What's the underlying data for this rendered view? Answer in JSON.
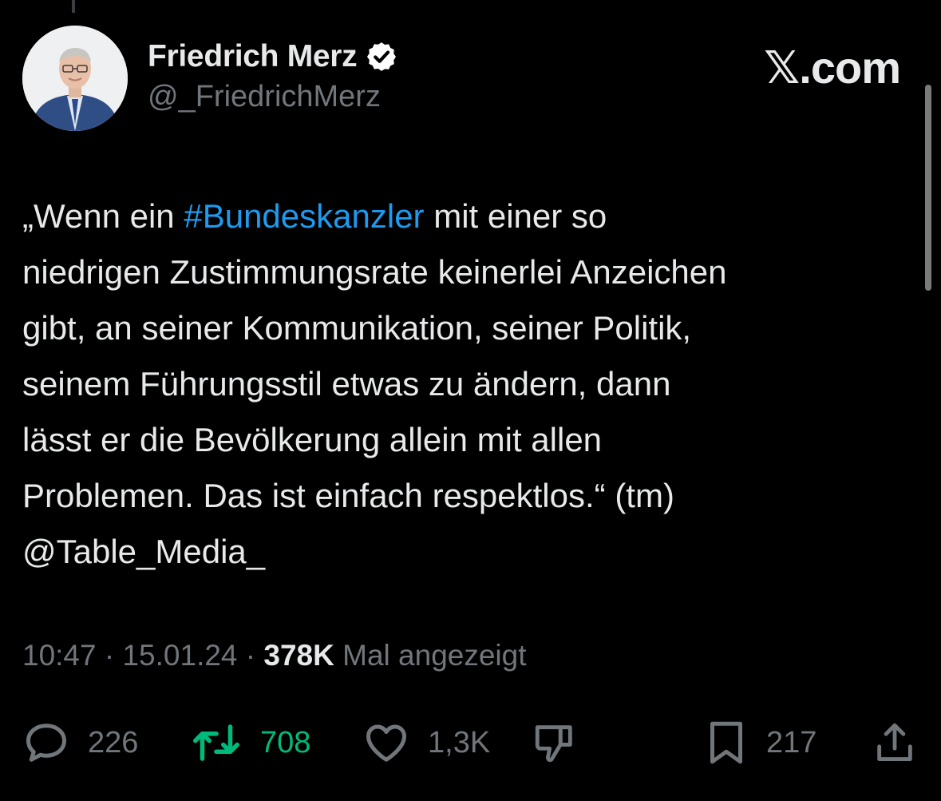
{
  "author": {
    "display_name": "Friedrich Merz",
    "handle": "@_FriedrichMerz"
  },
  "brand": "𝕏.com",
  "tweet": {
    "lines": [
      [
        "„Wenn ein ",
        "#Bundeskanzler",
        " mit einer so"
      ],
      "niedrigen Zustimmungsrate keinerlei Anzeichen",
      "gibt, an seiner Kommunikation, seiner Politik,",
      "seinem Führungsstil etwas zu ändern, dann",
      "lässt er die Bevölkerung allein mit allen",
      "Problemen. Das ist einfach respektlos.“ (tm)",
      "@Table_Media_"
    ]
  },
  "meta": {
    "time": "10:47",
    "separator": " · ",
    "date": "15.01.24",
    "views": "378K",
    "views_label": "Mal angezeigt"
  },
  "actions": {
    "replies": "226",
    "reposts": "708",
    "likes": "1,3K",
    "bookmarks": "217"
  },
  "colors": {
    "background": "#000000",
    "text": "#e7e9ea",
    "muted": "#71767b",
    "link": "#1d9bf0",
    "repost": "#00ba7c"
  },
  "icons": [
    "verified-badge-icon",
    "reply-icon",
    "repost-icon",
    "like-icon",
    "dislike-icon",
    "bookmark-icon",
    "share-icon"
  ]
}
